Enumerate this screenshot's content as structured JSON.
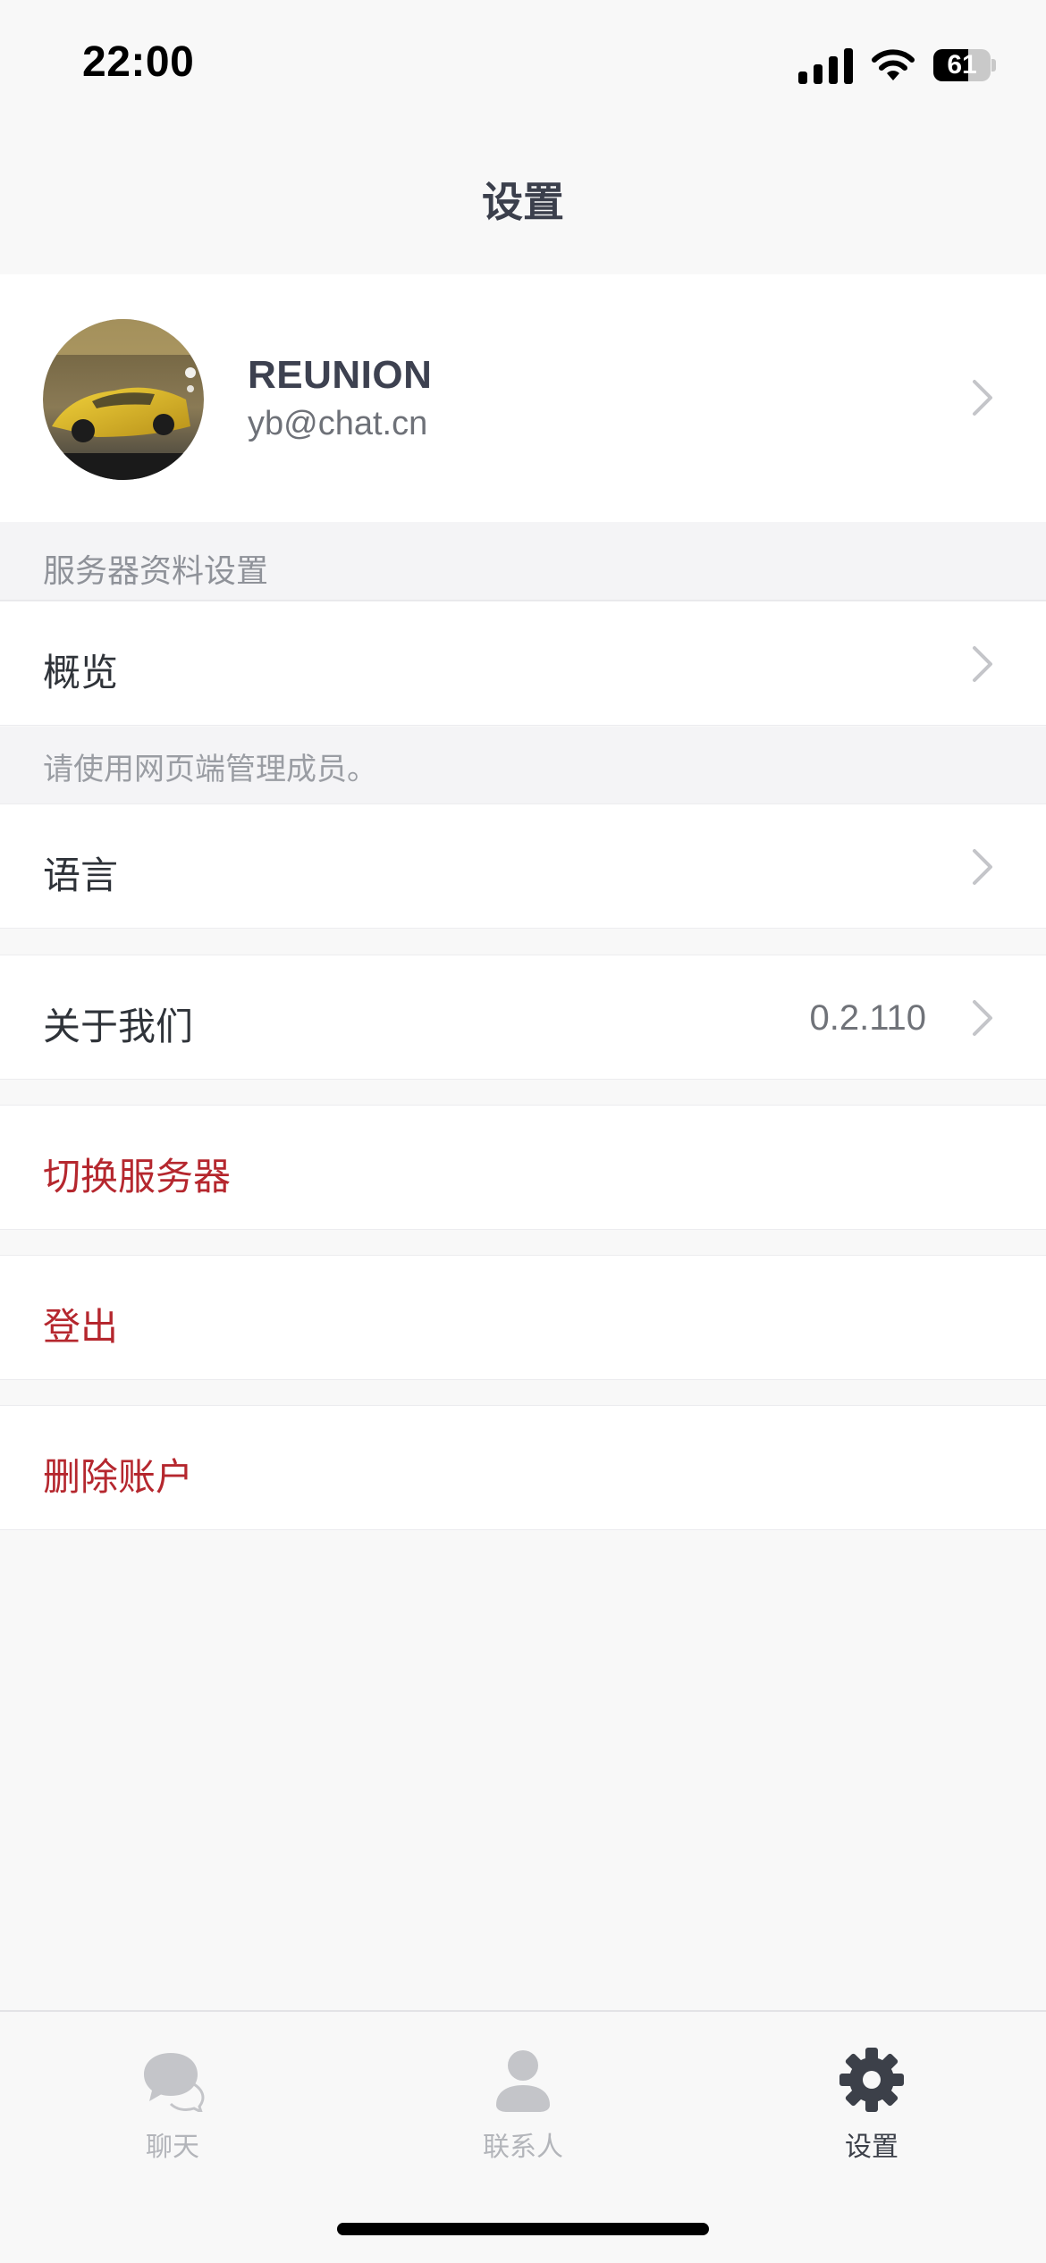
{
  "status_bar": {
    "time": "22:00",
    "battery": "61",
    "battery_level": 0.61
  },
  "header": {
    "title": "设置"
  },
  "profile": {
    "name": "REUNION",
    "email": "yb@chat.cn"
  },
  "server_section": {
    "title": "服务器资料设置",
    "overview_label": "概览",
    "note": "请使用网页端管理成员。"
  },
  "settings": {
    "language_label": "语言",
    "about_label": "关于我们",
    "version": "0.2.110",
    "switch_server_label": "切换服务器",
    "logout_label": "登出",
    "delete_account_label": "删除账户"
  },
  "tabs": [
    {
      "label": "聊天",
      "icon": "chat-bubbles-icon",
      "active": false
    },
    {
      "label": "联系人",
      "icon": "person-icon",
      "active": false
    },
    {
      "label": "设置",
      "icon": "gear-icon",
      "active": true
    }
  ],
  "colors": {
    "danger": "#b5272e",
    "active_tab": "#3c4049",
    "inactive_tab": "#b3b5ba"
  }
}
